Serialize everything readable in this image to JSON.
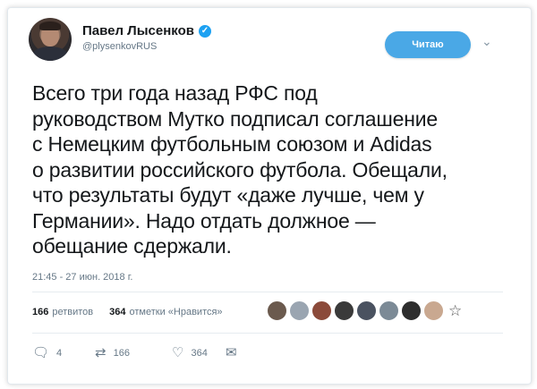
{
  "author": {
    "name": "Павел Лысенков",
    "handle": "@plysenkovRUS",
    "verified_icon": "verified-badge-icon"
  },
  "header": {
    "follow_label": "Читаю",
    "menu_icon": "chevron-down-icon"
  },
  "tweet": {
    "text": "Всего три года назад РФС под\nруководством Мутко подписал соглашение\nс Немецким футбольным союзом и Adidas\nо развитии российского футбола. Обещали,\nчто результаты будут «даже лучше, чем у\nГермании». Надо отдать должное —\nобещание сдержали.",
    "timestamp": "21:45 - 27 июн. 2018 г."
  },
  "stats": {
    "retweets_count": "166",
    "retweets_label": "ретвитов",
    "likes_count": "364",
    "likes_label": "отметки «Нравится»"
  },
  "liker_avatars": [
    {
      "color": "#6b5a4e"
    },
    {
      "color": "#9aa5b1"
    },
    {
      "color": "#8b4a3a"
    },
    {
      "color": "#3a3a3a"
    },
    {
      "color": "#4a5260"
    },
    {
      "color": "#7c8a96"
    },
    {
      "color": "#2e2e2e"
    },
    {
      "color": "#c9a890"
    }
  ],
  "actions": {
    "reply_count": "4",
    "retweet_count": "166",
    "like_count": "364"
  },
  "colors": {
    "accent": "#1da1f2",
    "follow_button": "#4aa8e6",
    "muted_text": "#657786"
  }
}
